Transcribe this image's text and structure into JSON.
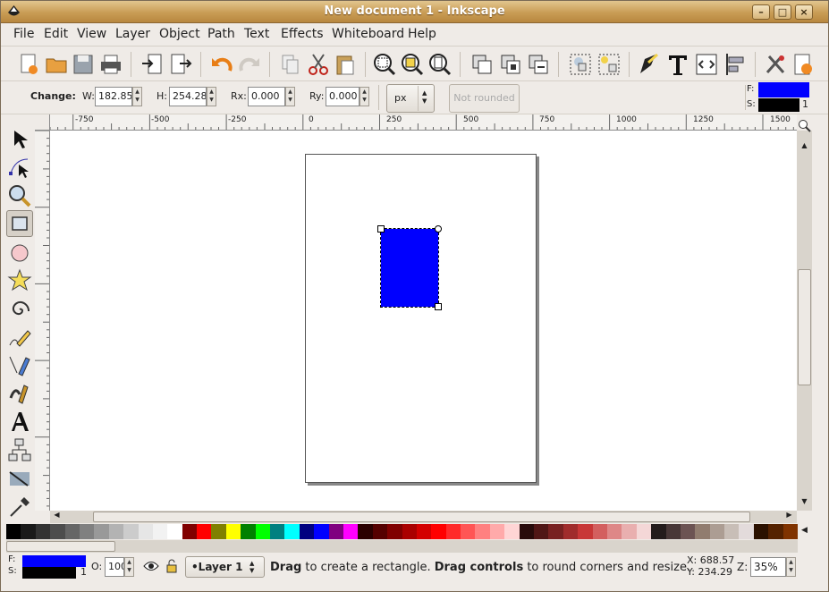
{
  "window": {
    "title": "New document 1 - Inkscape"
  },
  "menu": {
    "items": [
      "File",
      "Edit",
      "View",
      "Layer",
      "Object",
      "Path",
      "Text",
      "Effects",
      "Whiteboard",
      "Help"
    ]
  },
  "controls": {
    "change_label": "Change:",
    "w_label": "W:",
    "w_value": "182.85",
    "h_label": "H:",
    "h_value": "254.28",
    "rx_label": "Rx:",
    "rx_value": "0.000",
    "ry_label": "Ry:",
    "ry_value": "0.000",
    "unit": "px",
    "not_rounded": "Not rounded"
  },
  "style_indicator": {
    "fill_label": "F:",
    "stroke_label": "S:",
    "stroke_width": "1",
    "fill_color": "#0000ff",
    "stroke_color": "#000000"
  },
  "ruler": {
    "h_ticks": [
      "-750",
      "-500",
      "-250",
      "0",
      "250",
      "500",
      "750",
      "1000",
      "1250",
      "1500"
    ]
  },
  "canvas": {
    "shape_color": "#0000ff"
  },
  "status": {
    "fill_label": "F:",
    "stroke_label": "S:",
    "stroke_width": "1",
    "opacity_label": "O:",
    "opacity_value": "100",
    "layer": "•Layer 1",
    "msg_b1": "Drag",
    "msg_t1": " to create a rectangle. ",
    "msg_b2": "Drag controls",
    "msg_t2": " to round corners and resize.",
    "x_readout": "X: 688.57",
    "y_readout": "Y: 234.29",
    "zoom_label": "Z:",
    "zoom_value": "35%"
  },
  "palette": [
    "#000000",
    "#1a1a1a",
    "#333333",
    "#4d4d4d",
    "#666666",
    "#808080",
    "#999999",
    "#b3b3b3",
    "#cccccc",
    "#e6e6e6",
    "#f2f2f2",
    "#ffffff",
    "#800000",
    "#ff0000",
    "#808000",
    "#ffff00",
    "#008000",
    "#00ff00",
    "#008080",
    "#00ffff",
    "#000080",
    "#0000ff",
    "#800080",
    "#ff00ff",
    "#2b0000",
    "#550000",
    "#800000",
    "#aa0000",
    "#d40000",
    "#ff0000",
    "#ff2a2a",
    "#ff5555",
    "#ff8080",
    "#ffaaaa",
    "#ffd5d5",
    "#280b0b",
    "#501616",
    "#782121",
    "#a02c2c",
    "#c83737",
    "#d35f5f",
    "#de8787",
    "#e9afaf",
    "#f4d7d7",
    "#241c1c",
    "#483737",
    "#6c5353",
    "#917c6f",
    "#ac9d93",
    "#c8beb7",
    "#e3dbdb",
    "#2b1100",
    "#552200",
    "#803300"
  ]
}
